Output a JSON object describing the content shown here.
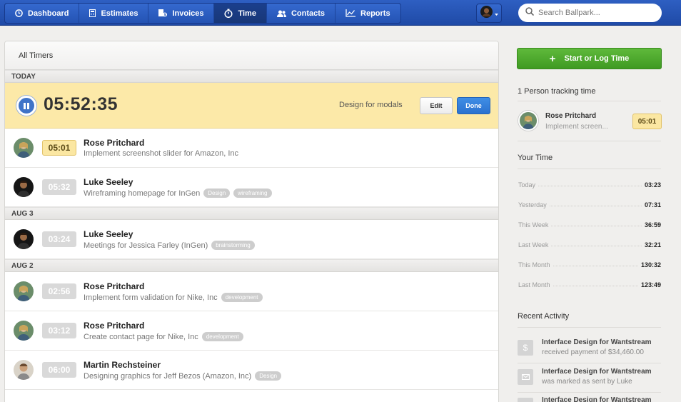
{
  "nav": {
    "items": [
      {
        "label": "Dashboard",
        "icon": "clock-icon"
      },
      {
        "label": "Estimates",
        "icon": "calculator-icon"
      },
      {
        "label": "Invoices",
        "icon": "invoice-icon"
      },
      {
        "label": "Time",
        "icon": "stopwatch-icon",
        "active": true
      },
      {
        "label": "Contacts",
        "icon": "people-icon"
      },
      {
        "label": "Reports",
        "icon": "chart-icon"
      }
    ]
  },
  "search": {
    "placeholder": "Search Ballpark..."
  },
  "panel": {
    "title": "All Timers",
    "today_label": "TODAY",
    "active_timer": {
      "time": "05:52:35",
      "description": "Design for modals",
      "edit_label": "Edit",
      "done_label": "Done"
    },
    "groups": [
      {
        "day": "TODAY",
        "entries": [
          {
            "time": "05:01",
            "name": "Rose Pritchard",
            "desc": "Implement screenshot slider for Amazon, Inc",
            "tags": [],
            "live": true
          },
          {
            "time": "05:32",
            "name": "Luke Seeley",
            "desc": "Wireframing homepage for InGen",
            "tags": [
              "Design",
              "wireframing"
            ]
          }
        ]
      },
      {
        "day": "AUG 3",
        "entries": [
          {
            "time": "03:24",
            "name": "Luke Seeley",
            "desc": "Meetings for Jessica Farley (InGen)",
            "tags": [
              "brainstorming"
            ]
          }
        ]
      },
      {
        "day": "AUG 2",
        "entries": [
          {
            "time": "02:56",
            "name": "Rose Pritchard",
            "desc": "Implement form validation for Nike, Inc",
            "tags": [
              "development"
            ]
          },
          {
            "time": "03:12",
            "name": "Rose Pritchard",
            "desc": "Create contact page for Nike, Inc",
            "tags": [
              "development"
            ]
          },
          {
            "time": "06:00",
            "name": "Martin Rechsteiner",
            "desc": "Designing graphics for Jeff Bezos (Amazon, Inc)",
            "tags": [
              "Design"
            ]
          }
        ]
      }
    ]
  },
  "sidebar": {
    "start_label": "Start or Log Time",
    "tracking_title": "1 Person tracking time",
    "tracker": {
      "name": "Rose Pritchard",
      "task": "Implement screen...",
      "time": "05:01"
    },
    "your_time_title": "Your Time",
    "your_time": [
      {
        "label": "Today",
        "value": "03:23"
      },
      {
        "label": "Yesterday",
        "value": "07:31"
      },
      {
        "label": "This Week",
        "value": "36:59"
      },
      {
        "label": "Last Week",
        "value": "32:21"
      },
      {
        "label": "This Month",
        "value": "130:32"
      },
      {
        "label": "Last Month",
        "value": "123:49"
      }
    ],
    "recent_title": "Recent Activity",
    "activity": [
      {
        "title": "Interface Design for Wantstream",
        "sub": "received payment of $34,460.00",
        "icon": "dollar-icon"
      },
      {
        "title": "Interface Design for Wantstream",
        "sub": "was marked as sent by Luke",
        "icon": "envelope-icon"
      },
      {
        "title": "Interface Design for Wantstream",
        "sub": "",
        "icon": "document-icon"
      }
    ]
  },
  "colors": {
    "nav": "#2453b3",
    "active_row": "#fce9a8",
    "done_button": "#2b72cf",
    "start_button": "#4aa72c"
  }
}
